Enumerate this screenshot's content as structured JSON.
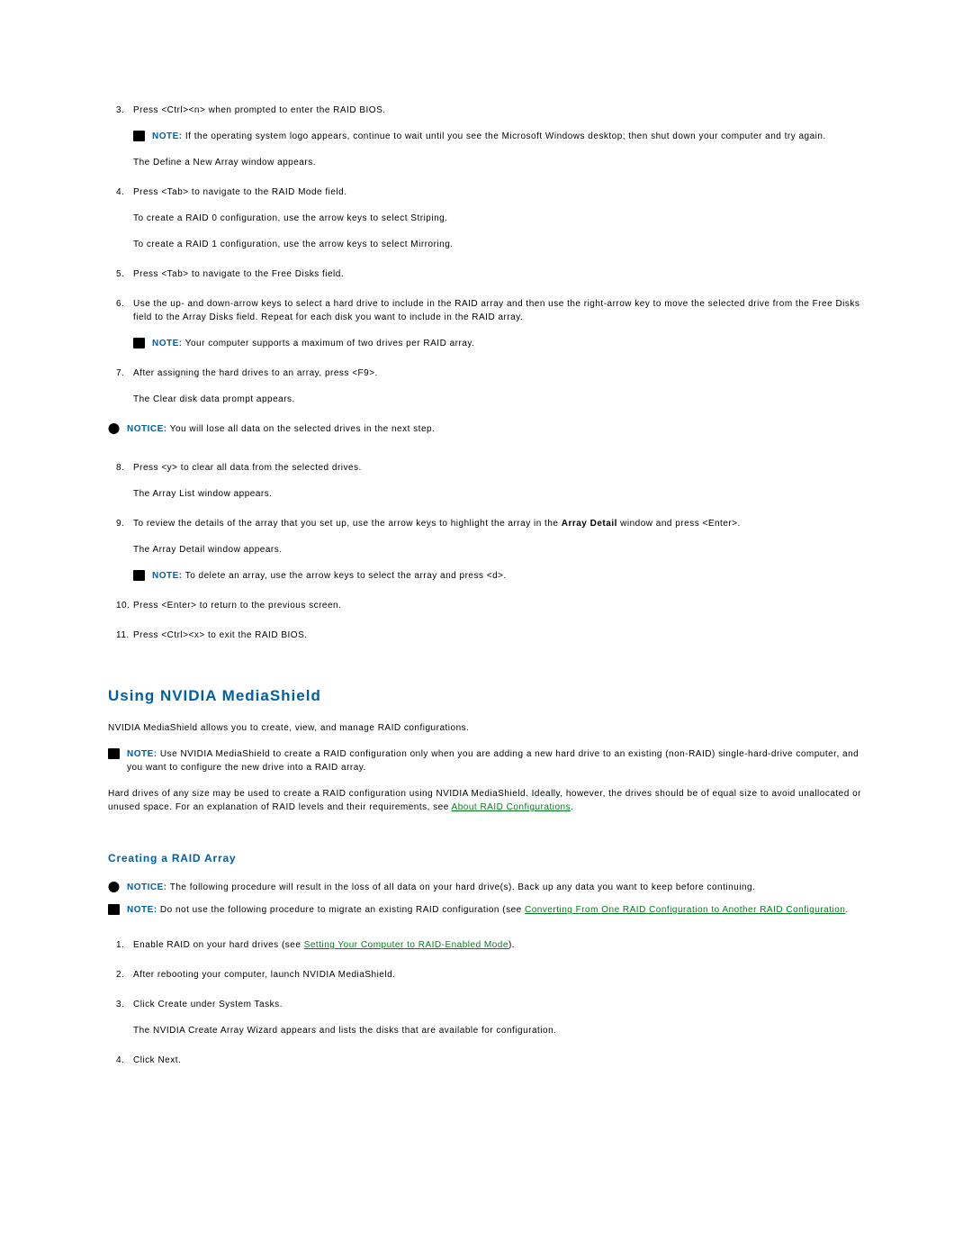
{
  "steps": {
    "3": {
      "text": "Press <Ctrl><n> when prompted to enter the RAID BIOS."
    },
    "3note": "If the operating system logo appears, continue to wait until you see the Microsoft Windows desktop; then shut down your computer and try again.",
    "3sub": "The Define a New Array window appears.",
    "4": {
      "text": "Press <Tab> to navigate to the RAID Mode field."
    },
    "4sub1": "To create a RAID 0 configuration, use the arrow keys to select Striping.",
    "4sub2": "To create a RAID 1 configuration, use the arrow keys to select Mirroring.",
    "5": {
      "text": "Press <Tab> to navigate to the Free Disks field."
    },
    "6": {
      "text": "Use the up- and down-arrow keys to select a hard drive to include in the RAID array and then use the right-arrow key to move the selected drive from the Free Disks field to the Array Disks field. Repeat for each disk you want to include in the RAID array."
    },
    "6note": "Your computer supports a maximum of two drives per RAID array.",
    "7": {
      "text": "After assigning the hard drives to an array, press <F9>."
    },
    "7sub": "The Clear disk data prompt appears.",
    "notice1": "You will lose all data on the selected drives in the next step.",
    "8": {
      "text": "Press <y> to clear all data from the selected drives."
    },
    "8sub": "The Array List window appears.",
    "9a": "To review the details of the array that you set up, use the arrow keys to highlight the array in the ",
    "9b": "Array Detail",
    "9c": " window and press <Enter>.",
    "9sub": "The Array Detail window appears.",
    "9note": "To delete an array, use the arrow keys to select the array and press <d>.",
    "10": {
      "text": "Press <Enter> to return to the previous screen."
    },
    "11": {
      "text": "Press <Ctrl><x> to exit the RAID BIOS."
    }
  },
  "section2": {
    "title": "Using NVIDIA MediaShield",
    "intro": "NVIDIA MediaShield allows you to create, view, and manage RAID configurations.",
    "note": "Use NVIDIA MediaShield to create a RAID configuration only when you are adding a new hard drive to an existing (non-RAID) single-hard-drive computer, and you want to configure the new drive into a RAID array.",
    "body_a": "Hard drives of any size may be used to create a RAID configuration using NVIDIA MediaShield. Ideally, however, the drives should be of equal size to avoid unallocated or unused space. For an explanation of RAID levels and their requirements, see ",
    "link1": "About RAID Configurations",
    "body_b": "."
  },
  "subsection": {
    "title": "Creating a RAID Array",
    "notice": "The following procedure will result in the loss of all data on your hard drive(s). Back up any data you want to keep before continuing.",
    "note_a": "Do not use the following procedure to migrate an existing RAID configuration (see ",
    "link2": "Converting From One RAID Configuration to Another RAID Configuration",
    "note_b": ".",
    "st1a": "Enable RAID on your hard drives (see ",
    "st1link": "Setting Your Computer to RAID-Enabled Mode",
    "st1b": ").",
    "st2": "After rebooting your computer, launch NVIDIA MediaShield.",
    "st3": "Click Create under System Tasks.",
    "st3sub": "The NVIDIA Create Array Wizard appears and lists the disks that are available for configuration.",
    "st4": "Click Next."
  },
  "labels": {
    "note": "NOTE:",
    "notice": "NOTICE:"
  }
}
